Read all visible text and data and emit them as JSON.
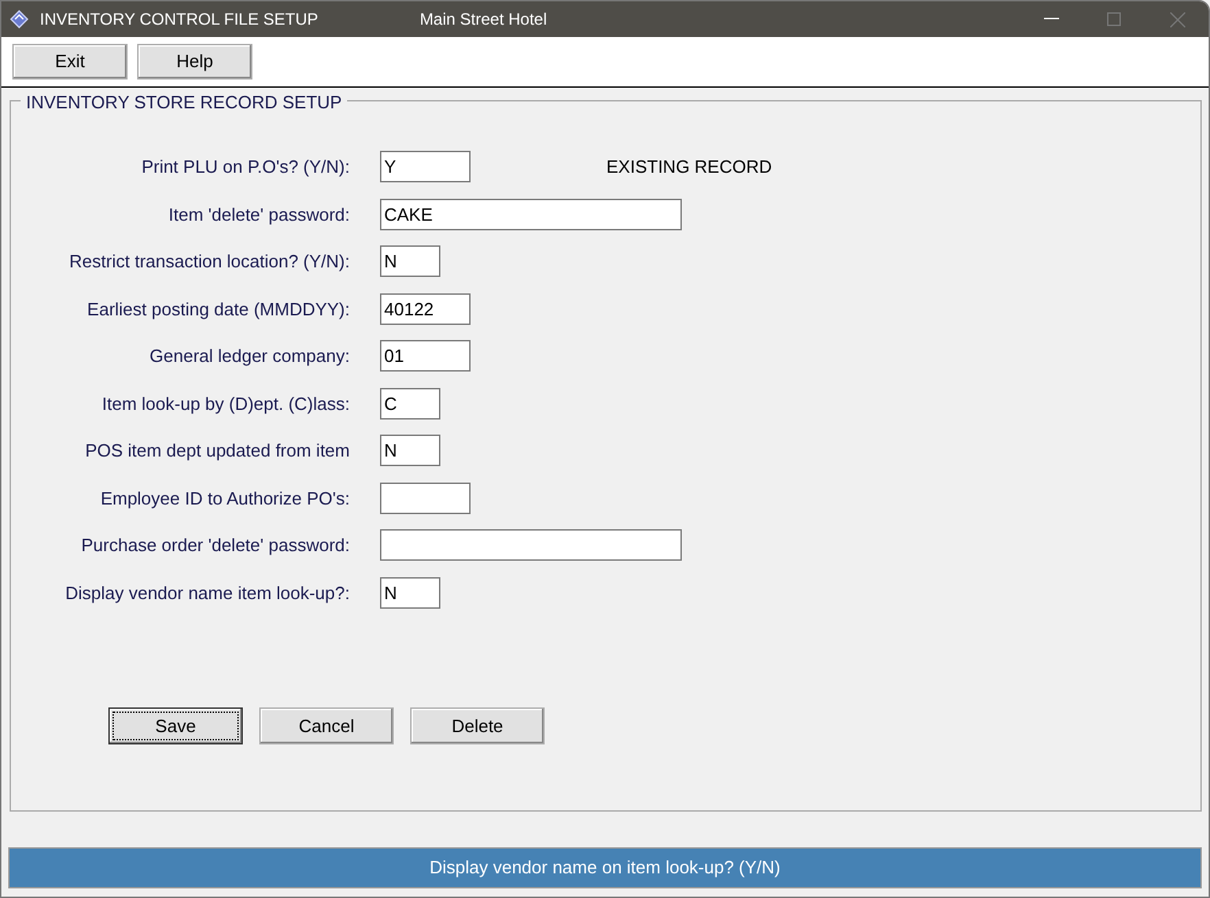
{
  "window": {
    "title": "INVENTORY CONTROL FILE SETUP",
    "subtitle": "Main Street Hotel"
  },
  "toolbar": [
    "Exit",
    "Help"
  ],
  "group": {
    "title": "INVENTORY STORE RECORD SETUP",
    "record_status": "EXISTING RECORD",
    "fields": [
      {
        "label": "Print PLU on P.O's? (Y/N):",
        "value": "Y",
        "kind": "medium"
      },
      {
        "label": "Item 'delete' password:",
        "value": "CAKE",
        "kind": "long"
      },
      {
        "label": "Restrict transaction location? (Y/N):",
        "value": "N",
        "kind": "short"
      },
      {
        "label": "Earliest posting date (MMDDYY):",
        "value": "40122",
        "kind": "medium"
      },
      {
        "label": "General ledger company:",
        "value": "01",
        "kind": "medium"
      },
      {
        "label": "Item look-up by (D)ept. (C)lass:",
        "value": "C",
        "kind": "short"
      },
      {
        "label": "POS item dept updated from item",
        "value": "N",
        "kind": "short"
      },
      {
        "label": "Employee ID to Authorize PO's:",
        "kind": "medium"
      },
      {
        "label": "Purchase order 'delete' password:",
        "kind": "long"
      },
      {
        "label": "Display vendor name item look-up?:",
        "value": "N",
        "kind": "short"
      }
    ],
    "buttons": [
      {
        "label": "Save",
        "focused": true
      },
      {
        "label": "Cancel",
        "focused": false
      },
      {
        "label": "Delete",
        "focused": false
      }
    ]
  },
  "status_bar": "Display vendor name on item look-up? (Y/N)"
}
